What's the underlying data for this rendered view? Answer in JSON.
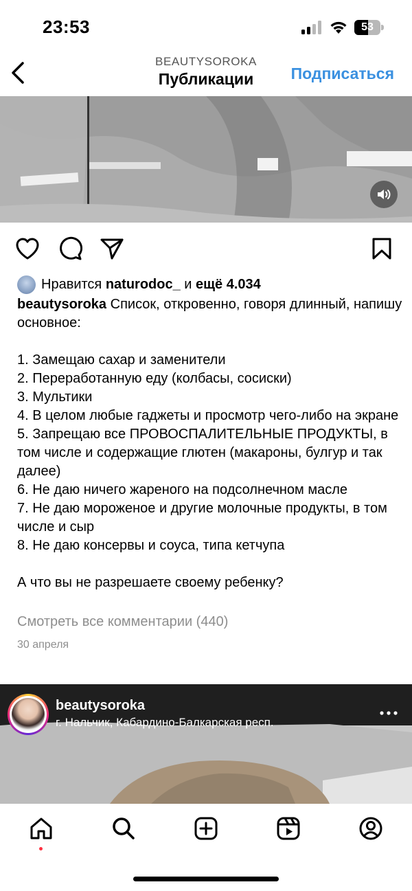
{
  "status_bar": {
    "time": "23:53",
    "battery_level": "53",
    "battery_fraction": 0.53
  },
  "header": {
    "username": "BEAUTYSOROKA",
    "title": "Публикации",
    "follow_label": "Подписаться"
  },
  "post": {
    "likes": {
      "prefix": "Нравится",
      "liker": "naturodoc_",
      "mid": "и",
      "count_text": "ещё 4.034"
    },
    "caption": {
      "username": "beautysoroka",
      "text": " Список, откровенно, говоря длинный, напишу основное:\n\n1. Замещаю сахар и заменители\n2. Переработанную еду (колбасы, сосиски)\n3. Мультики\n4. В целом любые гаджеты и просмотр чего-либо на экране\n5. Запрещаю все ПРОВОСПАЛИТЕЛЬНЫЕ ПРОДУКТЫ, в том числе и содержащие глютен (макароны, булгур и так далее)\n6. Не даю ничего жареного на подсолнечном масле\n7. Не даю мороженое и другие молочные продукты, в том числе и сыр\n8. Не даю консервы и соуса, типа кетчупа\n\nА что вы не разрешаете своему ребенку?"
    },
    "comments_link": "Смотреть все комментарии (440)",
    "date": "30 апреля"
  },
  "next_post": {
    "username": "beautysoroka",
    "location": "г. Нальчик, Кабардино-Балкарская респ."
  },
  "icons": {
    "back": "chevron-left-icon",
    "sound": "speaker-icon",
    "like": "heart-icon",
    "comment": "comment-bubble-icon",
    "share": "paper-plane-icon",
    "save": "bookmark-icon",
    "more": "ellipsis-icon",
    "home": "home-icon",
    "search": "search-icon",
    "create": "plus-square-icon",
    "reels": "reels-icon",
    "profile": "profile-icon"
  },
  "colors": {
    "accent": "#3a90e0",
    "secondary_text": "#8e8e8e",
    "notification": "#ff3040"
  }
}
